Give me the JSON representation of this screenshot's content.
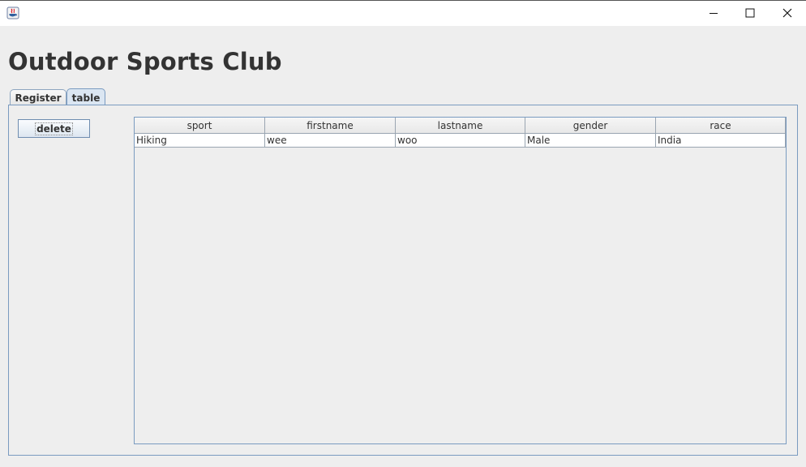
{
  "window": {
    "app_icon": "java-cup-icon",
    "controls": [
      "minimize-icon",
      "maximize-icon",
      "close-icon"
    ]
  },
  "heading": "Outdoor Sports Club",
  "tabs": [
    {
      "label": "Register",
      "selected": false
    },
    {
      "label": "table",
      "selected": true
    }
  ],
  "panel": {
    "delete_label": "delete",
    "table": {
      "columns": [
        "sport",
        "firstname",
        "lastname",
        "gender",
        "race"
      ],
      "rows": [
        [
          "Hiking",
          "wee",
          "woo",
          "Male",
          "India"
        ]
      ]
    }
  },
  "colors": {
    "background": "#eeeeee",
    "border_accent": "#7a9bc0",
    "selected_tab": "#dbe6f2"
  }
}
